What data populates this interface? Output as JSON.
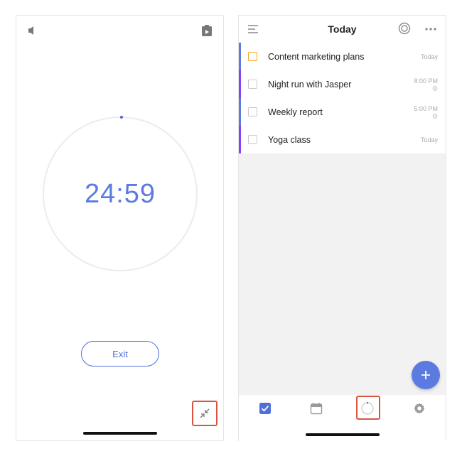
{
  "timer_screen": {
    "time": "24:59",
    "exit_label": "Exit",
    "icons": {
      "speaker": "speaker-icon",
      "clipboard": "clipboard-icon",
      "minimize": "minimize-icon"
    }
  },
  "list_screen": {
    "title": "Today",
    "tasks": [
      {
        "title": "Content marketing plans",
        "date": "Today",
        "bar_color": "#5b7be0",
        "check_color": "#f5a623",
        "alarm": false
      },
      {
        "title": "Night run with Jasper",
        "date": "8:00 PM",
        "bar_color": "#8a3ffc",
        "check_color": "#c9c9c9",
        "alarm": true
      },
      {
        "title": "Weekly report",
        "date": "5:00 PM",
        "bar_color": "#5b7be0",
        "check_color": "#c9c9c9",
        "alarm": true
      },
      {
        "title": "Yoga class",
        "date": "Today",
        "bar_color": "#8a3ffc",
        "check_color": "#c9c9c9",
        "alarm": false
      }
    ],
    "nav": [
      "check-icon",
      "calendar-icon",
      "focus-timer-icon",
      "settings-gear-icon"
    ]
  },
  "colors": {
    "accent": "#5b7be0",
    "highlight": "#d9553f"
  }
}
